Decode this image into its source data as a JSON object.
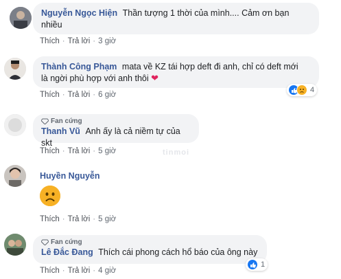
{
  "actions": {
    "like": "Thích",
    "reply": "Trả lời",
    "sep": "·"
  },
  "fan_badge": "Fan cứng",
  "watermark": "tinmoi",
  "comments": [
    {
      "name": "Nguyễn Ngọc Hiện",
      "text_line1": "Thần tượng 1 thời của mình.... Cảm ơn bạn",
      "text_line2": "nhiều",
      "time": "3 giờ"
    },
    {
      "name": "Thành Công Phạm",
      "text_line1": "mata về KZ tái hợp deft đi anh, chỉ có deft mới",
      "text_line2": "là ngời phù hợp với anh thôi",
      "heart": "❤️",
      "time": "6 giờ",
      "reaction_count": "4"
    },
    {
      "name": "Thanh Vũ",
      "text": "Anh ấy là cả niềm tự của skt",
      "time": "5 giờ"
    },
    {
      "name": "Huyền Nguyễn",
      "emoji": "sad-face",
      "time": "5 giờ"
    },
    {
      "name": "Lê Đắc Đang",
      "text": "Thích cái phong cách hổ báo của ông này",
      "time": "4 giờ",
      "reaction_count": "1"
    }
  ],
  "colors": {
    "name": "#385898",
    "bubble": "#f2f3f5",
    "like": "#1877f2",
    "heart": "#e0245e",
    "sad": "#f7b125"
  }
}
